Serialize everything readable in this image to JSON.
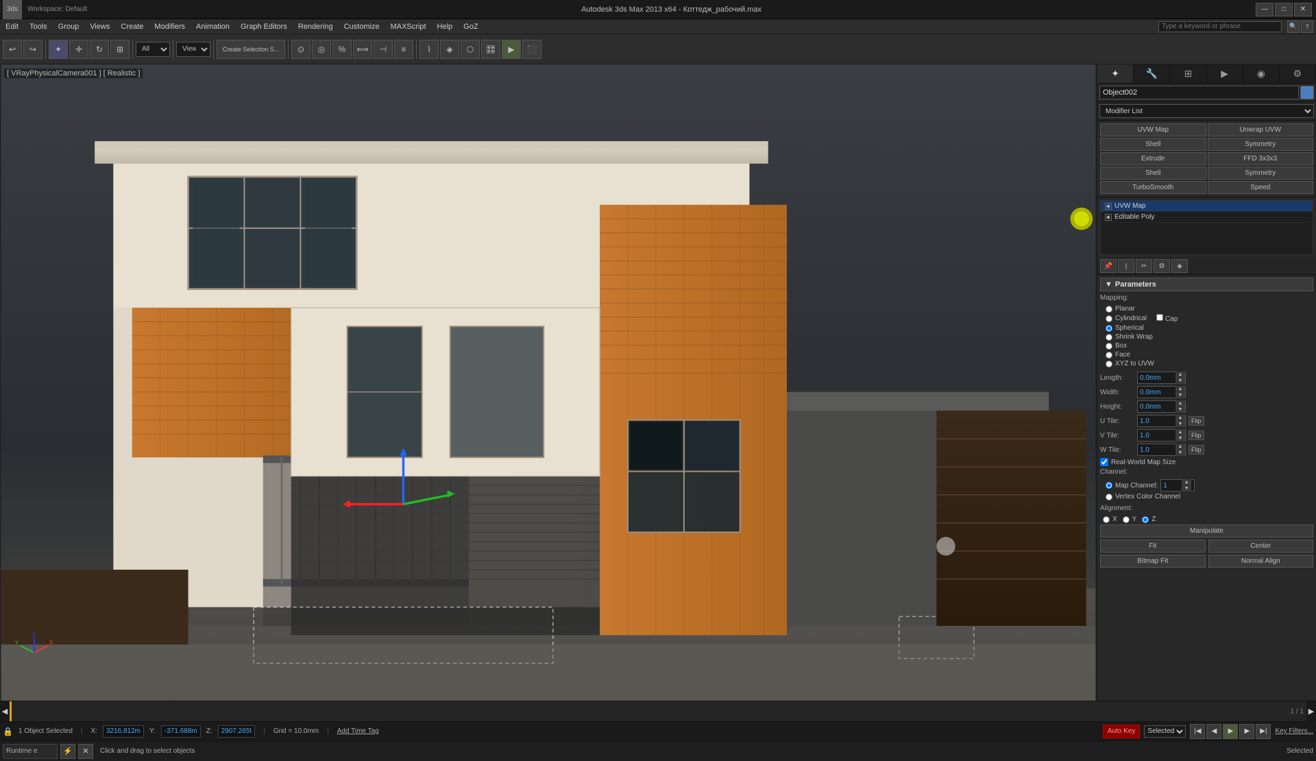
{
  "titlebar": {
    "app_title": "Autodesk 3ds Max 2013 x64 - Коттедж_рабочий.max",
    "workspace": "Workspace: Default",
    "min_label": "—",
    "max_label": "□",
    "close_label": "✕"
  },
  "menubar": {
    "items": [
      "Edit",
      "Tools",
      "Group",
      "Views",
      "Create",
      "Modifiers",
      "Animation",
      "Graph Editors",
      "Rendering",
      "Customize",
      "MAXScript",
      "Help",
      "GoZ"
    ],
    "search_placeholder": "Type a keyword or phrase"
  },
  "viewport": {
    "label": "[ VRayPhysicalCamera001 ] [ Realistic ]"
  },
  "panel": {
    "object_name": "Object002",
    "modifier_list_label": "Modifier List",
    "modifiers": [
      {
        "label": "UVW Map",
        "col": 0
      },
      {
        "label": "Unwrap UVW",
        "col": 1
      },
      {
        "label": "Shell",
        "col": 0
      },
      {
        "label": "Symmetry",
        "col": 1
      },
      {
        "label": "Extrude",
        "col": 0
      },
      {
        "label": "FFD 3x3x3",
        "col": 1
      },
      {
        "label": "Shell",
        "col": 0
      },
      {
        "label": "Symmetry",
        "col": 1
      },
      {
        "label": "TurboSmooth",
        "col": 0
      },
      {
        "label": "Speed",
        "col": 1
      }
    ],
    "stack": [
      {
        "label": "UVW Map",
        "selected": true
      },
      {
        "label": "Editable Poly",
        "selected": false
      }
    ],
    "params_header": "Parameters",
    "mapping_label": "Mapping:",
    "mapping_options": [
      {
        "label": "Planar",
        "selected": false
      },
      {
        "label": "Cylindrical",
        "selected": false
      },
      {
        "label": "Cap",
        "selected": false
      },
      {
        "label": "Spherical",
        "selected": true
      },
      {
        "label": "Shrink Wrap",
        "selected": false
      },
      {
        "label": "Box",
        "selected": true
      },
      {
        "label": "Face",
        "selected": false
      },
      {
        "label": "XYZ to UVW",
        "selected": false
      }
    ],
    "length_label": "Length:",
    "length_val": "0.0mm",
    "width_label": "Width:",
    "width_val": "0.0mm",
    "height_label": "Height:",
    "height_val": "0.0mm",
    "u_tile_label": "U Tile:",
    "u_tile_val": "1.0",
    "v_tile_label": "V Tile:",
    "v_tile_val": "1.0",
    "w_tile_label": "W Tile:",
    "w_tile_val": "1.0",
    "flip_label": "Flip",
    "real_world_label": "Real-World Map Size",
    "channel_label": "Channel:",
    "map_channel_label": "Map Channel:",
    "map_channel_val": "1",
    "vertex_color_label": "Vertex Color Channel",
    "alignment_label": "Alignment:",
    "align_x": "X",
    "align_y": "Y",
    "align_z": "Z",
    "manipulate_label": "Manipulate",
    "fit_label": "Fit",
    "center_label": "Center",
    "bitmap_fit_label": "Bitmap Fit",
    "normal_align_label": "Normal Align"
  },
  "statusbar": {
    "object_selected": "1 Object Selected",
    "x_label": "X:",
    "x_val": "3216.812m",
    "y_label": "Y:",
    "y_val": "-371.688m",
    "z_label": "Z:",
    "z_val": "2907.265t",
    "grid_label": "Grid = 10.0mm",
    "autokey_label": "Auto Key",
    "selected_label": "Selected",
    "add_time_tag": "Add Time Tag",
    "key_filters": "Key Filters..."
  },
  "promptbar": {
    "runtime_label": "Runtime e",
    "prompt_text": "Click and drag to select objects",
    "selected_status": "Selected"
  },
  "timeline": {
    "frame": "1 / 1"
  }
}
